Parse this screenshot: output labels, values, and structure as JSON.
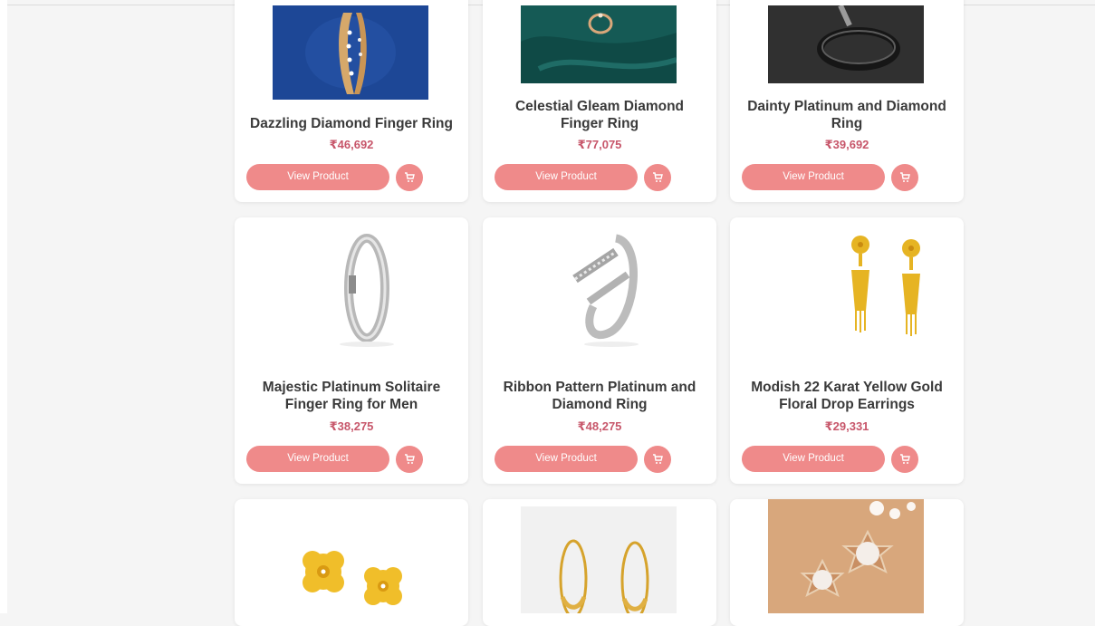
{
  "products": [
    {
      "name": "Dazzling Diamond Finger Ring",
      "price": "₹46,692",
      "view_label": "View Product",
      "image": "gold-diamond-band-on-blue"
    },
    {
      "name": "Celestial Gleam Diamond Finger Ring",
      "price": "₹77,075",
      "view_label": "View Product",
      "image": "ring-on-green-velvet"
    },
    {
      "name": "Dainty Platinum and Diamond Ring",
      "price": "₹39,692",
      "view_label": "View Product",
      "image": "platinum-ring-on-dark"
    },
    {
      "name": "Majestic Platinum Solitaire Finger Ring for Men",
      "price": "₹38,275",
      "view_label": "View Product",
      "image": "platinum-band"
    },
    {
      "name": "Ribbon Pattern Platinum and Diamond Ring",
      "price": "₹48,275",
      "view_label": "View Product",
      "image": "platinum-crossover-ring"
    },
    {
      "name": "Modish 22 Karat Yellow Gold Floral Drop Earrings",
      "price": "₹29,331",
      "view_label": "View Product",
      "image": "gold-drop-earrings"
    },
    {
      "name": "",
      "price": "",
      "view_label": "",
      "image": "gold-flower-stud-earrings"
    },
    {
      "name": "",
      "price": "",
      "view_label": "",
      "image": "gold-hoop-earrings"
    },
    {
      "name": "",
      "price": "",
      "view_label": "",
      "image": "pearl-star-stud-earrings"
    }
  ],
  "colors": {
    "accent": "#ef8a8a",
    "price": "#c7566a",
    "title": "#3a3a3a",
    "background": "#f5f5f5"
  }
}
